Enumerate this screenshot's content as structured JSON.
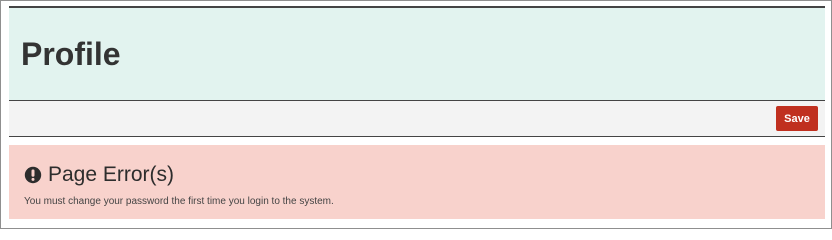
{
  "page": {
    "title": "Profile"
  },
  "toolbar": {
    "save_label": "Save"
  },
  "error": {
    "icon": "exclamation-circle-icon",
    "title": "Page Error(s)",
    "message": "You must change your password the first time you login to the system."
  },
  "colors": {
    "header_background": "#e2f3ef",
    "toolbar_background": "#f3f3f3",
    "save_button": "#c0301f",
    "error_background": "#f8d2cc",
    "text": "#333333"
  }
}
